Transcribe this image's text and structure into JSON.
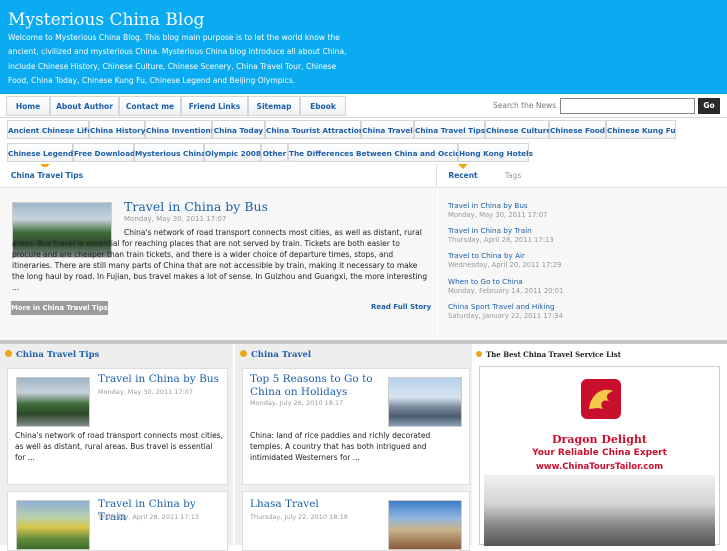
{
  "header": {
    "title": "Mysterious China Blog",
    "description": "Welcome to Mysterious China Blog. This blog main purpose is to let the world know the ancient, civilized and mysterious China. Mysterious China blog introduce all about China, include Chinese History, Chinese Culture, Chinese Scenery, China Travel Tour, Chinese Food, China Today, Chinese Kung Fu, Chinese Legend and Beijing Olympics.",
    "bg_color": "#0aabf0"
  },
  "nav": {
    "items": [
      "Home",
      "About Author",
      "Contact me",
      "Friend Links",
      "Sitemap",
      "Ebook"
    ],
    "search_label": "Search the News",
    "search_value": "",
    "search_button": "Go"
  },
  "categories": {
    "row1": [
      "Ancient Chinese Life",
      "China History",
      "China Inventions",
      "China Today",
      "China Tourist Attractions",
      "China Travel",
      "China Travel Tips",
      "Chinese Culture",
      "Chinese Food",
      "Chinese Kung Fu"
    ],
    "row2": [
      "Chinese Legend",
      "Free Download",
      "Mysterious China",
      "Olympic 2008",
      "Other",
      "The Differences Between China and Occident",
      "Hong Kong Hotels"
    ]
  },
  "featured": {
    "tab": "China Travel Tips",
    "title": "Travel in China by Bus",
    "date": "Monday, May 30, 2011 17:07",
    "text": "China's network of road transport connects most cities, as well as distant, rural areas. Bus travel is essential for reaching places that are not served by train. Tickets are both easier to procure and are cheaper than train tickets, and there is a wider choice of departure times, stops, and itineraries. There are still many parts of China that are not accessible by train, making it necessary to make the long haul by road. In Fujian, bus travel makes a lot of sense. In Guizhou and Guangxi, the more interesting ...",
    "more_button": "More in China Travel Tips",
    "read_link": "Read Full Story"
  },
  "recent": {
    "tab_recent": "Recent",
    "tab_tags": "Tags",
    "items": [
      {
        "title": "Travel in China by Bus",
        "date": "Monday, May 30, 2011 17:07"
      },
      {
        "title": "Travel in China by Train",
        "date": "Thursday, April 28, 2011 17:13"
      },
      {
        "title": "Travel to China by Air",
        "date": "Wednesday, April 20, 2011 17:29"
      },
      {
        "title": "When to Go to China",
        "date": "Monday, February 14, 2011 20:01"
      },
      {
        "title": "China Sport Travel and Hiking",
        "date": "Saturday, January 22, 2011 17:34"
      }
    ]
  },
  "col1": {
    "heading": "China Travel Tips",
    "cards": [
      {
        "title": "Travel in China by Bus",
        "date": "Monday, May 30, 2011 17:07",
        "text": "China's network of road transport connects most cities, as well as distant, rural areas. Bus travel is essential for ..."
      },
      {
        "title": "Travel in China by Train",
        "date": "Thursday, April 28, 2011 17:13",
        "text": ""
      }
    ]
  },
  "col2": {
    "heading": "China Travel",
    "cards": [
      {
        "title": "Top 5 Reasons to Go to China on Holidays",
        "date": "Monday, July 26, 2010 18:17",
        "text": "China: land of rice paddies and richly decorated temples. A country that has both intrigued and intimidated Westerners for ..."
      },
      {
        "title": "Lhasa Travel",
        "date": "Thursday, July 22, 2010 18:18",
        "text": ""
      }
    ]
  },
  "col3": {
    "heading": "The Best China Travel Service List",
    "ad_brand": "Dragon Delight",
    "ad_tagline": "Your Reliable China Expert",
    "ad_url": "www.ChinaToursTailor.com"
  }
}
